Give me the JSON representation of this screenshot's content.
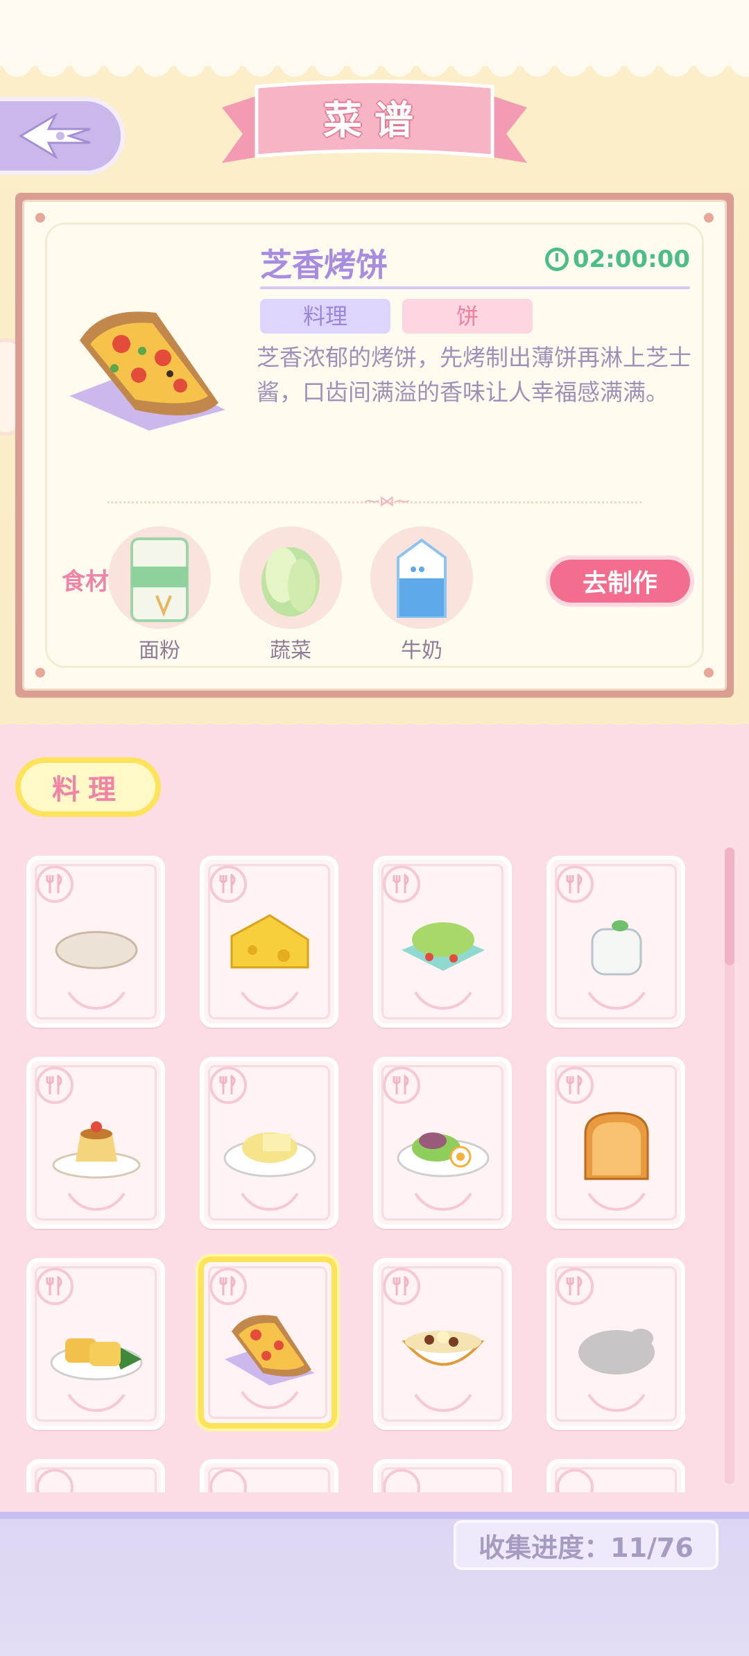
{
  "header": {
    "title": "菜谱"
  },
  "recipe": {
    "name": "芝香烤饼",
    "timer": "02:00:00",
    "tags": [
      "料理",
      "饼"
    ],
    "description": "芝香浓郁的烤饼，先烤制出薄饼再淋上芝士酱，口齿间满溢的香味让人幸福感满满。",
    "ingredients_label": "食材",
    "ingredients": [
      {
        "name": "面粉",
        "icon": "flour-icon"
      },
      {
        "name": "蔬菜",
        "icon": "cabbage-icon"
      },
      {
        "name": "牛奶",
        "icon": "milk-icon"
      }
    ],
    "make_button": "去制作"
  },
  "category": {
    "label": "料理"
  },
  "grid": {
    "items": [
      {
        "icon": "flatbread-icon",
        "selected": false
      },
      {
        "icon": "cheese-icon",
        "selected": false
      },
      {
        "icon": "salad-icon",
        "selected": false
      },
      {
        "icon": "yogurt-icon",
        "selected": false
      },
      {
        "icon": "pudding-icon",
        "selected": false
      },
      {
        "icon": "cheese-plate-icon",
        "selected": false
      },
      {
        "icon": "veggie-plate-icon",
        "selected": false
      },
      {
        "icon": "bread-loaf-icon",
        "selected": false
      },
      {
        "icon": "egg-roll-icon",
        "selected": false
      },
      {
        "icon": "pizza-icon",
        "selected": true
      },
      {
        "icon": "soup-bowl-icon",
        "selected": false
      },
      {
        "icon": "locked-silhouette-icon",
        "selected": false
      }
    ]
  },
  "footer": {
    "progress": "收集进度：11/76"
  },
  "colors": {
    "accent_purple": "#a88ce0",
    "accent_pink": "#f26d8e",
    "timer_green": "#4bbd8a",
    "highlight_yellow": "#fde35b"
  }
}
